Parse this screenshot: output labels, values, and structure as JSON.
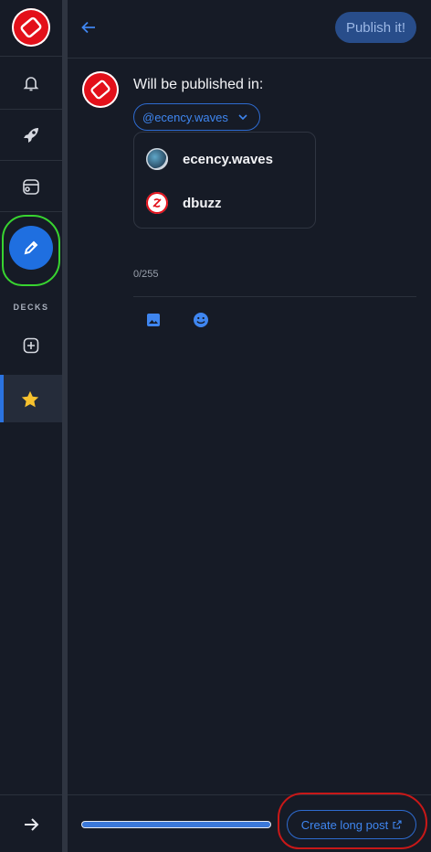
{
  "sidebar": {
    "logo": "ecency-logo",
    "items": [
      {
        "name": "notifications",
        "icon": "bell-icon"
      },
      {
        "name": "discover",
        "icon": "rocket-icon"
      },
      {
        "name": "wallet",
        "icon": "wallet-icon"
      },
      {
        "name": "compose",
        "icon": "pencil-icon"
      }
    ],
    "decks_label": "DECKS",
    "add_deck_icon": "plus-square-icon",
    "favorites_icon": "star-icon",
    "collapse_icon": "arrow-right-icon"
  },
  "topbar": {
    "back_icon": "arrow-left-icon",
    "publish_label": "Publish it!"
  },
  "composer": {
    "publish_in_label": "Will be published in:",
    "selected_account": "@ecency.waves",
    "accounts": [
      {
        "name": "ecency.waves"
      },
      {
        "name": "dbuzz"
      }
    ],
    "char_counter": "0/255",
    "tools": [
      {
        "icon": "image-icon"
      },
      {
        "icon": "emoji-icon"
      }
    ]
  },
  "footer": {
    "progress": 1.0,
    "create_long_post_label": "Create long post",
    "external_link_icon": "external-link-icon"
  },
  "colors": {
    "accent": "#1f6fe0",
    "background": "#161b26",
    "brand_red": "#e3101a",
    "annotation_green": "#38d430",
    "annotation_red": "#c81818"
  }
}
